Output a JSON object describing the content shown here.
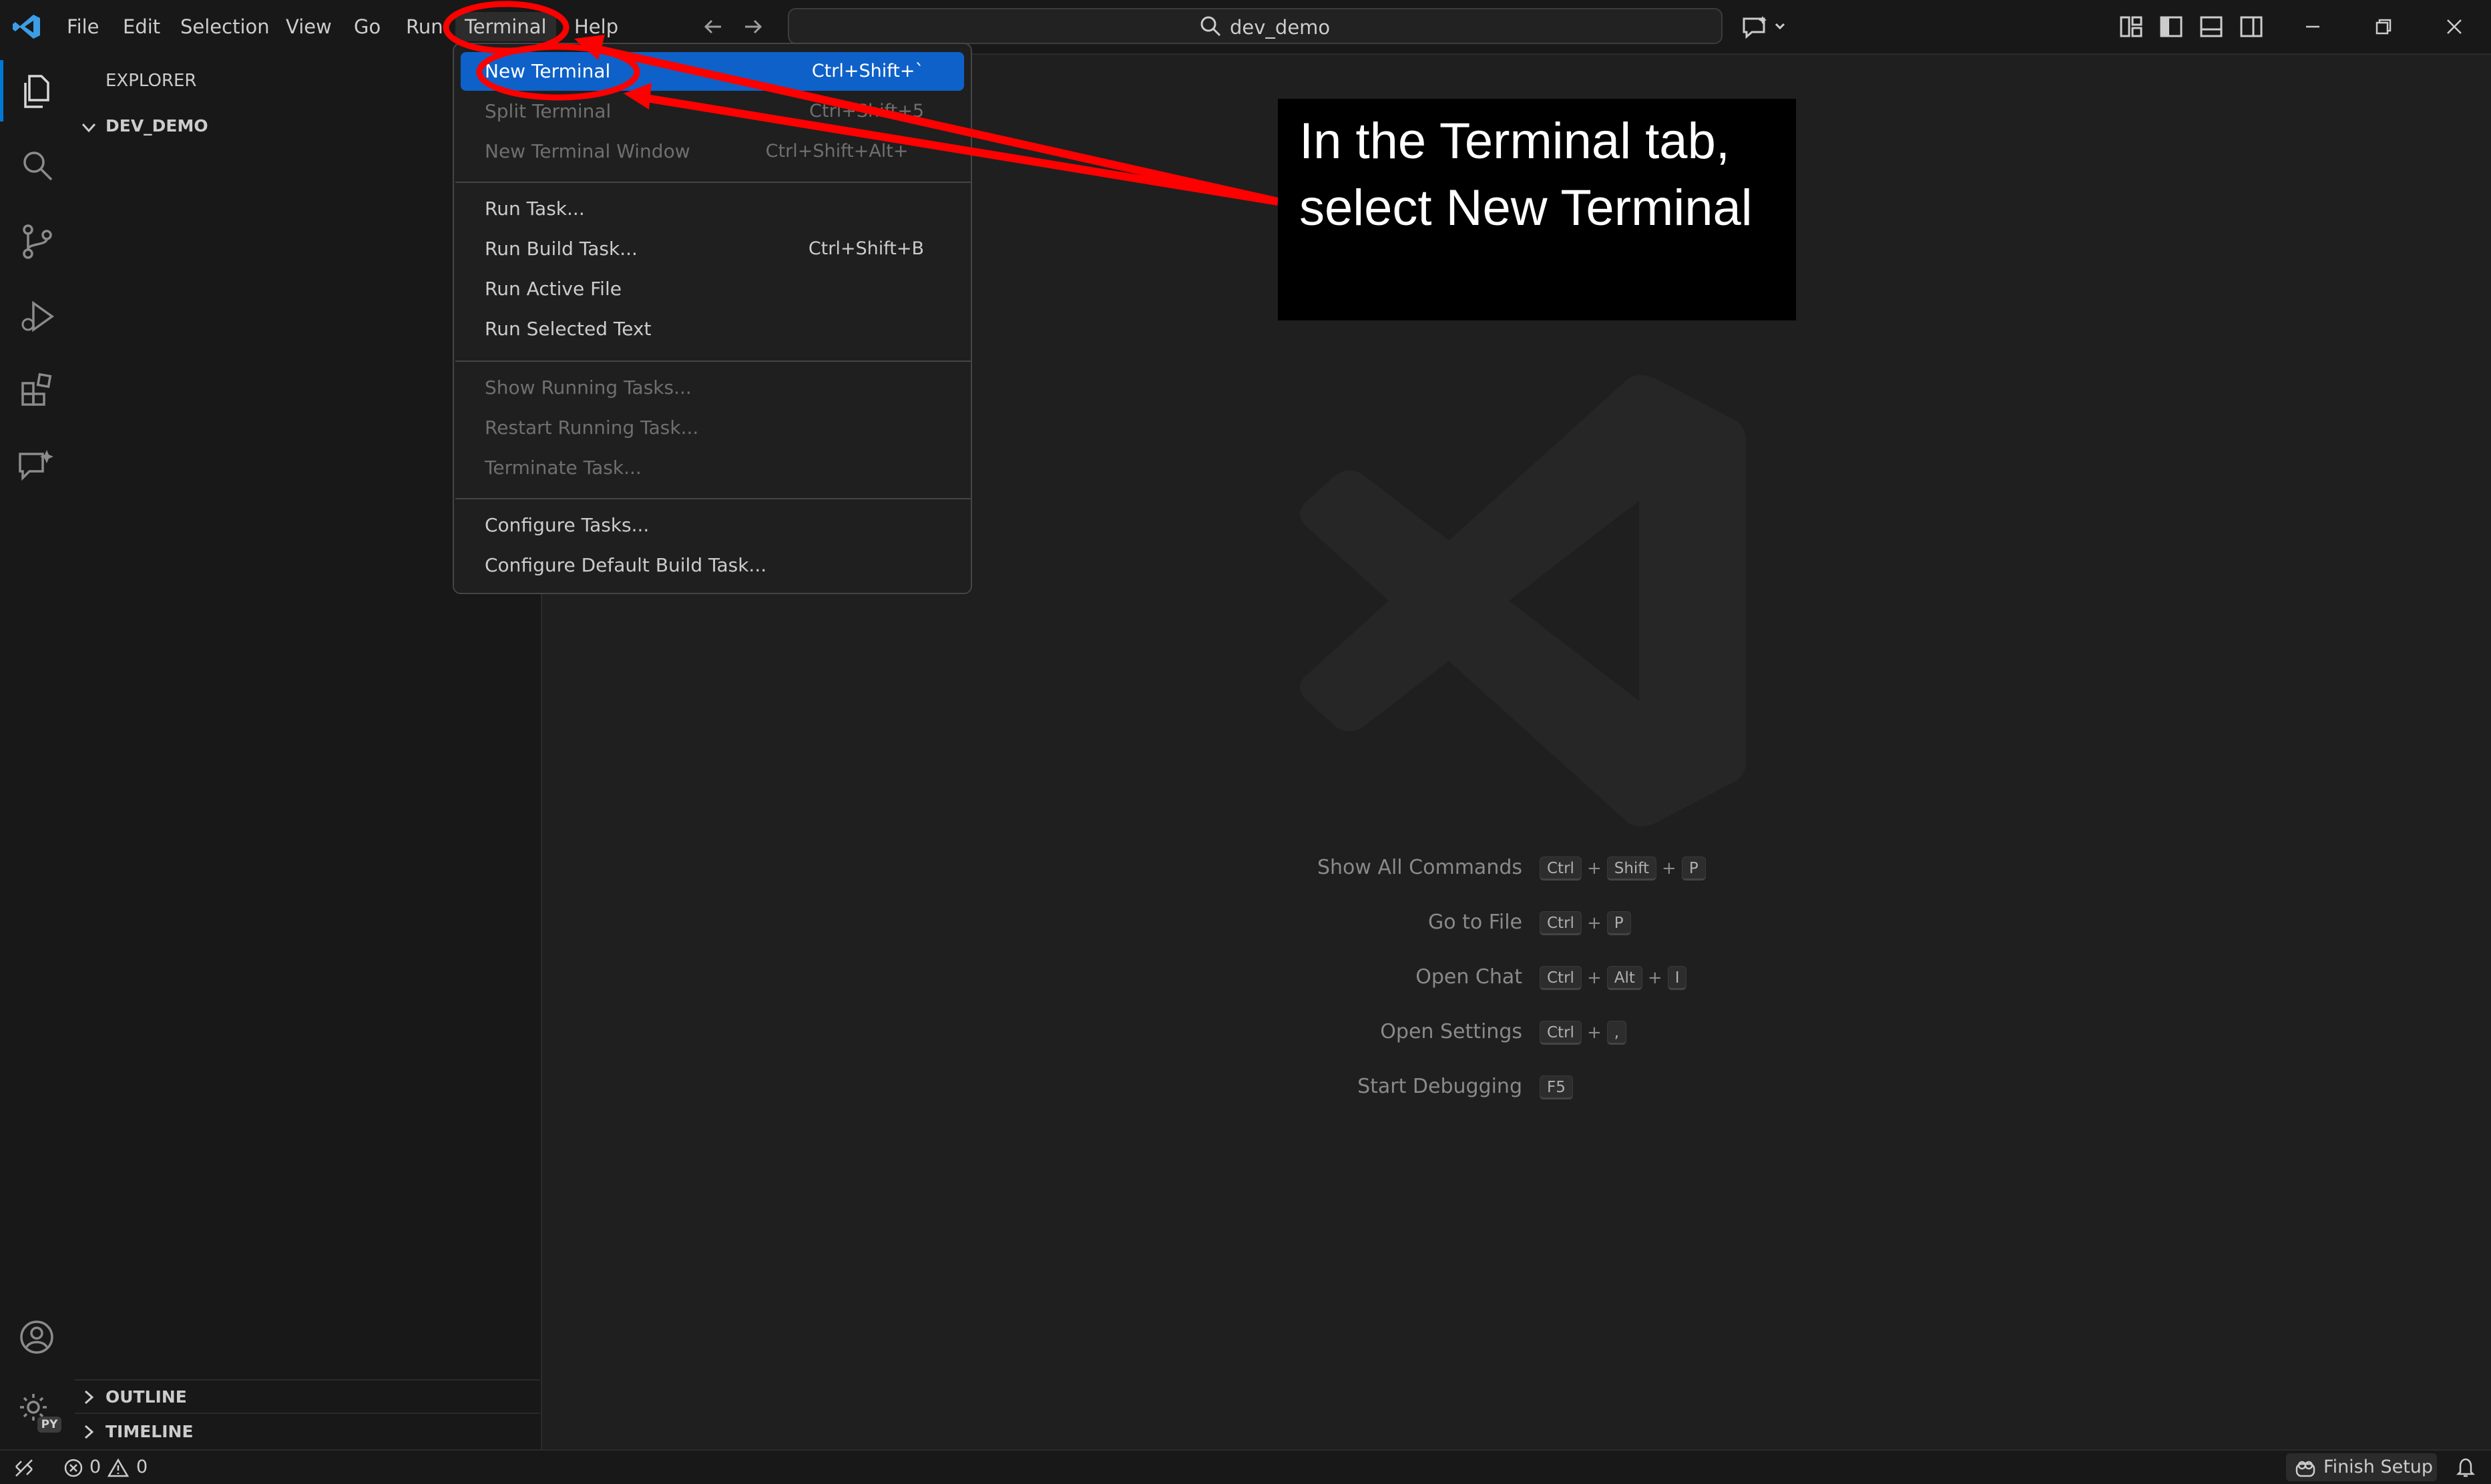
{
  "titlebar": {
    "menus": [
      "File",
      "Edit",
      "Selection",
      "View",
      "Go",
      "Run",
      "Terminal",
      "Help"
    ],
    "search_text": "dev_demo"
  },
  "sidebar": {
    "header": "EXPLORER",
    "folder": "DEV_DEMO",
    "outline": "OUTLINE",
    "timeline": "TIMELINE"
  },
  "terminal_menu": {
    "groups": [
      [
        {
          "label": "New Terminal",
          "shortcut": "Ctrl+Shift+`",
          "state": "highlighted"
        },
        {
          "label": "Split Terminal",
          "shortcut": "Ctrl+Shift+5",
          "state": "disabled"
        },
        {
          "label": "New Terminal Window",
          "shortcut": "Ctrl+Shift+Alt+`",
          "state": "disabled"
        }
      ],
      [
        {
          "label": "Run Task...",
          "shortcut": "",
          "state": "enabled"
        },
        {
          "label": "Run Build Task...",
          "shortcut": "Ctrl+Shift+B",
          "state": "enabled"
        },
        {
          "label": "Run Active File",
          "shortcut": "",
          "state": "enabled"
        },
        {
          "label": "Run Selected Text",
          "shortcut": "",
          "state": "enabled"
        }
      ],
      [
        {
          "label": "Show Running Tasks...",
          "shortcut": "",
          "state": "disabled"
        },
        {
          "label": "Restart Running Task...",
          "shortcut": "",
          "state": "disabled"
        },
        {
          "label": "Terminate Task...",
          "shortcut": "",
          "state": "disabled"
        }
      ],
      [
        {
          "label": "Configure Tasks...",
          "shortcut": "",
          "state": "enabled"
        },
        {
          "label": "Configure Default Build Task...",
          "shortcut": "",
          "state": "enabled"
        }
      ]
    ]
  },
  "shortcuts": [
    {
      "label": "Show All Commands",
      "keys": [
        "Ctrl",
        "Shift",
        "P"
      ]
    },
    {
      "label": "Go to File",
      "keys": [
        "Ctrl",
        "P"
      ]
    },
    {
      "label": "Open Chat",
      "keys": [
        "Ctrl",
        "Alt",
        "I"
      ]
    },
    {
      "label": "Open Settings",
      "keys": [
        "Ctrl",
        ","
      ]
    },
    {
      "label": "Start Debugging",
      "keys": [
        "F5"
      ]
    }
  ],
  "annotation": {
    "text": "In the Terminal tab, select New Terminal",
    "color": "#ff0000"
  },
  "statusbar": {
    "errors": "0",
    "warnings": "0",
    "finish_setup": "Finish Setup",
    "badge": "PY"
  },
  "colors": {
    "accent": "#0078d4",
    "menu_highlight": "#0e61c9",
    "background": "#1f1f1f"
  }
}
